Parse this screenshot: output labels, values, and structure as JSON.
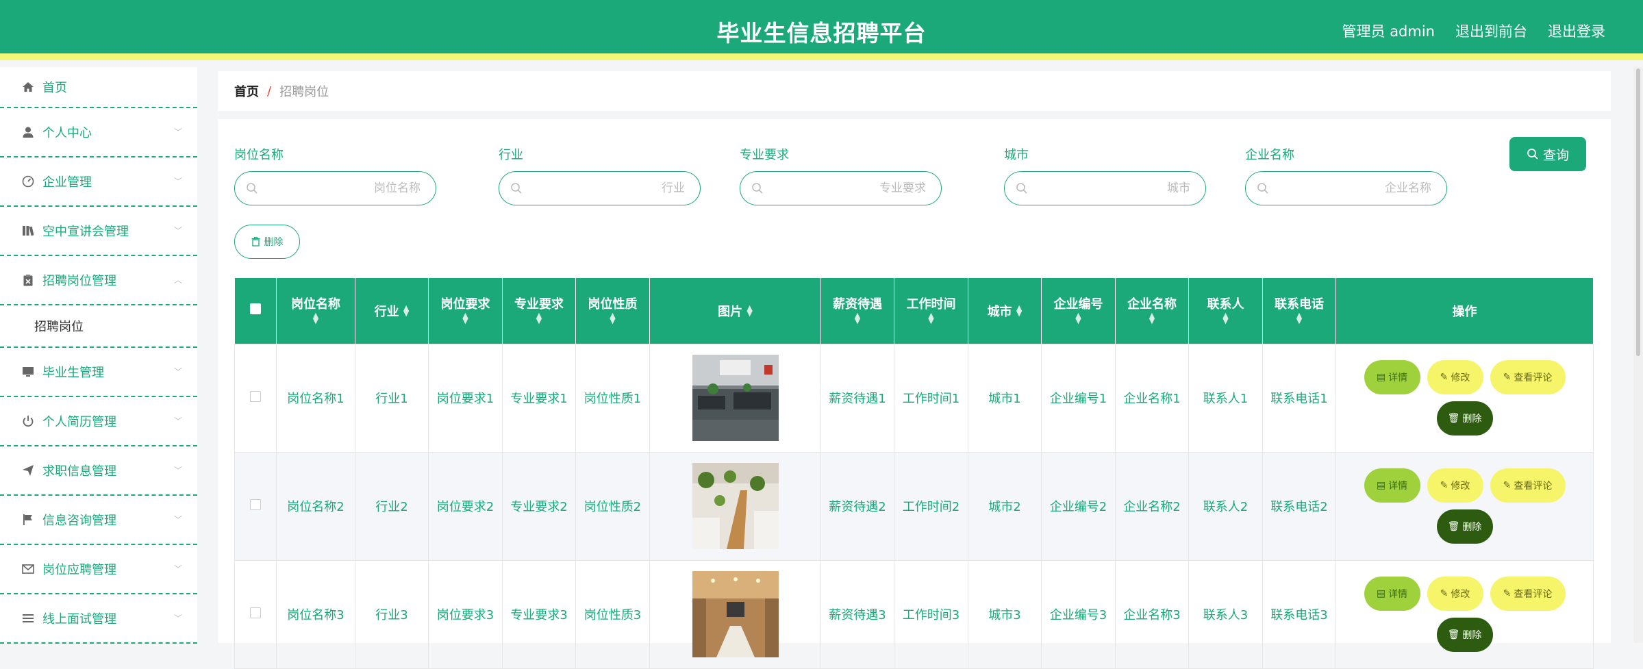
{
  "app": {
    "title": "毕业生信息招聘平台",
    "user_label": "管理员 admin",
    "front_link": "退出到前台",
    "logout_link": "退出登录"
  },
  "colors": {
    "primary": "#1ba97a",
    "accent_stripe": "#f2f77a",
    "detail_btn": "#9ed13c",
    "edit_btn": "#f6f56a",
    "delete_btn": "#2d5c10"
  },
  "sidebar": {
    "items": [
      {
        "label": "首页",
        "icon": "home-icon"
      },
      {
        "label": "个人中心",
        "icon": "user-icon"
      },
      {
        "label": "企业管理",
        "icon": "gauge-icon"
      },
      {
        "label": "空中宣讲会管理",
        "icon": "books-icon"
      },
      {
        "label": "招聘岗位管理",
        "icon": "clipboard-icon"
      },
      {
        "label": "毕业生管理",
        "icon": "monitor-icon"
      },
      {
        "label": "个人简历管理",
        "icon": "power-icon"
      },
      {
        "label": "求职信息管理",
        "icon": "send-icon"
      },
      {
        "label": "信息咨询管理",
        "icon": "flag-icon"
      },
      {
        "label": "岗位应聘管理",
        "icon": "mail-icon"
      },
      {
        "label": "线上面试管理",
        "icon": "list-icon"
      }
    ],
    "sub_item": "招聘岗位"
  },
  "breadcrumb": {
    "home": "首页",
    "sep": "/",
    "current": "招聘岗位"
  },
  "search": {
    "fields": [
      {
        "label": "岗位名称",
        "placeholder": "岗位名称"
      },
      {
        "label": "行业",
        "placeholder": "行业"
      },
      {
        "label": "专业要求",
        "placeholder": "专业要求"
      },
      {
        "label": "城市",
        "placeholder": "城市"
      },
      {
        "label": "企业名称",
        "placeholder": "企业名称"
      }
    ],
    "query_label": "查询",
    "delete_label": "删除"
  },
  "table": {
    "headers": [
      "岗位名称",
      "行业",
      "岗位要求",
      "专业要求",
      "岗位性质",
      "图片",
      "薪资待遇",
      "工作时间",
      "城市",
      "企业编号",
      "企业名称",
      "联系人",
      "联系电话",
      "操作"
    ],
    "rows": [
      {
        "name": "岗位名称1",
        "industry": "行业1",
        "req": "岗位要求1",
        "major": "专业要求1",
        "nature": "岗位性质1",
        "salary": "薪资待遇1",
        "time": "工作时间1",
        "city": "城市1",
        "code": "企业编号1",
        "company": "企业名称1",
        "contact": "联系人1",
        "phone": "联系电话1"
      },
      {
        "name": "岗位名称2",
        "industry": "行业2",
        "req": "岗位要求2",
        "major": "专业要求2",
        "nature": "岗位性质2",
        "salary": "薪资待遇2",
        "time": "工作时间2",
        "city": "城市2",
        "code": "企业编号2",
        "company": "企业名称2",
        "contact": "联系人2",
        "phone": "联系电话2"
      },
      {
        "name": "岗位名称3",
        "industry": "行业3",
        "req": "岗位要求3",
        "major": "专业要求3",
        "nature": "岗位性质3",
        "salary": "薪资待遇3",
        "time": "工作时间3",
        "city": "城市3",
        "code": "企业编号3",
        "company": "企业名称3",
        "contact": "联系人3",
        "phone": "联系电话3"
      }
    ],
    "actions": {
      "detail": "详情",
      "edit": "修改",
      "comment": "查看评论",
      "delete": "删除"
    }
  }
}
